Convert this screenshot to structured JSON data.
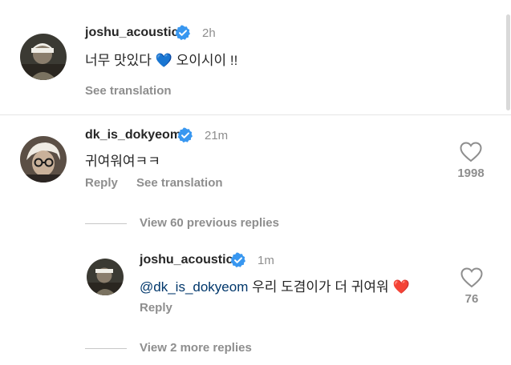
{
  "comment1": {
    "username": "joshu_acoustic",
    "time": "2h",
    "text": "너무 맛있다",
    "emoji": "💙",
    "text2": "오이시이 !!",
    "see_translation": "See translation"
  },
  "comment2": {
    "username": "dk_is_dokyeom",
    "time": "21m",
    "text": "귀여워여ㅋㅋ",
    "reply": "Reply",
    "see_translation": "See translation",
    "likes": "1998"
  },
  "view_previous": "View 60 previous replies",
  "reply1": {
    "username": "joshu_acoustic",
    "time": "1m",
    "mention": "@dk_is_dokyeom",
    "text": "우리 도겸이가 더 귀여워",
    "emoji": "❤️",
    "reply": "Reply",
    "likes": "76"
  },
  "view_more": "View 2 more replies",
  "colors": {
    "verified": "#3897f0",
    "mention": "#00376b",
    "meta": "#8e8e8e",
    "heart_emoji": "#e0245e"
  }
}
